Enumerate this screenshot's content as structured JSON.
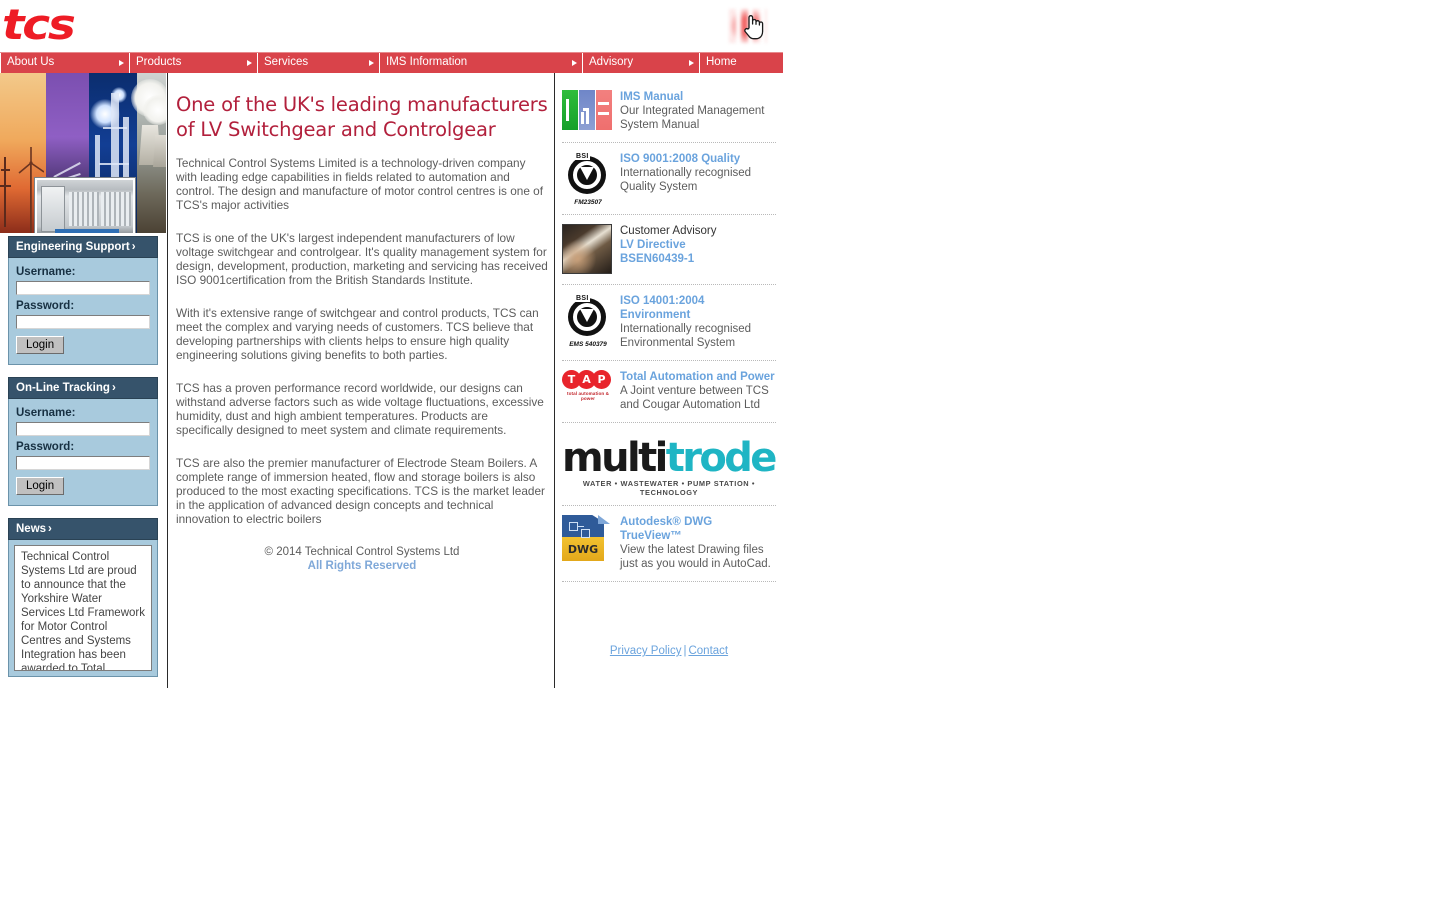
{
  "site": {
    "logo_text": "tcs",
    "cursor_icon": "hand-pointer-cursor"
  },
  "nav": {
    "items": [
      {
        "label": "About Us",
        "has_arrow": true
      },
      {
        "label": "Products",
        "has_arrow": true
      },
      {
        "label": "Services",
        "has_arrow": true
      },
      {
        "label": "IMS Information",
        "has_arrow": true
      },
      {
        "label": "Advisory",
        "has_arrow": true
      },
      {
        "label": "Home",
        "has_arrow": false
      }
    ]
  },
  "sidebar": {
    "engineering": {
      "title": "Engineering Support",
      "chevron": "›",
      "username_label": "Username:",
      "password_label": "Password:",
      "username_value": "",
      "password_value": "",
      "login_label": "Login"
    },
    "tracking": {
      "title": "On-Line Tracking",
      "chevron": "›",
      "username_label": "Username:",
      "password_label": "Password:",
      "username_value": "",
      "password_value": "",
      "login_label": "Login"
    },
    "news": {
      "title": "News",
      "chevron": "›",
      "body": "Technical Control Systems Ltd are proud to announce that the Yorkshire Water Services Ltd Framework for Motor Control Centres and Systems Integration has been awarded to Total Automation & Power"
    }
  },
  "main": {
    "heading": "One of the UK's leading manufacturers of LV Switchgear and Controlgear",
    "paragraphs": [
      "Technical Control Systems Limited is a technology-driven company with leading edge capabilities in fields related to automation and control. The design and manufacture of motor control centres is one of TCS's major activities",
      "TCS is one of the UK's largest independent manufacturers of low voltage switchgear and controlgear. It's quality management system for design, development, production, marketing and servicing has received ISO 9001certification from the British Standards Institute.",
      "With it's extensive range of switchgear and control products, TCS can meet the complex and varying needs of customers. TCS believe that developing partnerships with clients helps to ensure high quality engineering solutions giving benefits to both parties.",
      "TCS has a proven performance record worldwide, our designs can withstand adverse factors such as wide voltage fluctuations, excessive humidity, dust and high ambient temperatures. Products are specifically designed to meet system and climate requirements.",
      "TCS are also the premier manufacturer of Electrode Steam Boilers. A complete range of immersion heated, flow and storage boilers is also produced to the most exacting specifications. TCS is the market leader in the application of advanced design concepts and technical innovation to electric boilers"
    ],
    "copyright": "© 2014 Technical Control Systems Ltd",
    "rights": "All Rights Reserved"
  },
  "right_panel": {
    "items": [
      {
        "icon": "ims-logo-icon",
        "link": "IMS Manual",
        "lines": [
          "Our Integrated Management",
          "System Manual"
        ]
      },
      {
        "icon": "bsi-kitemark-icon",
        "badge_code": "FM23507",
        "link": "ISO 9001:2008 Quality",
        "lines": [
          "Internationally recognised",
          "Quality System"
        ]
      },
      {
        "icon": "advisory-photo-icon",
        "plain_head": "Customer Advisory",
        "link": "LV Directive",
        "link2": "BSEN60439-1"
      },
      {
        "icon": "bsi-kitemark-icon",
        "badge_code": "EMS 540379",
        "link": "ISO 14001:2004 Environment",
        "lines": [
          "Internationally recognised",
          "Environmental System"
        ]
      },
      {
        "icon": "tap-logo-icon",
        "link": "Total Automation and Power",
        "lines": [
          "A Joint venture between TCS",
          "and Cougar Automation Ltd"
        ]
      },
      {
        "icon": "dwg-file-icon",
        "link": "Autodesk® DWG TrueView™",
        "lines": [
          "View the latest Drawing files",
          "just as you would in AutoCad."
        ]
      }
    ],
    "multitrode": {
      "word_a": "multi",
      "word_b": "trode",
      "tagline": "WATER • WASTEWATER • PUMP STATION • TECHNOLOGY"
    },
    "tap_logo": {
      "t": "T",
      "a": "A",
      "p": "P",
      "tagline": "total automation & power"
    },
    "dwg_label": "DWG",
    "bsi_label": "BSI"
  },
  "footer": {
    "privacy": "Privacy Policy",
    "separator": "|",
    "contact": "Contact"
  },
  "colors": {
    "nav_red": "#d9434a",
    "logo_red": "#ee1c25",
    "heading_red": "#b2203c",
    "panel_head": "#36536b",
    "panel_body": "#a8cadd",
    "link_blue": "#6aa3dd",
    "body_grey": "#5c5c5c"
  }
}
